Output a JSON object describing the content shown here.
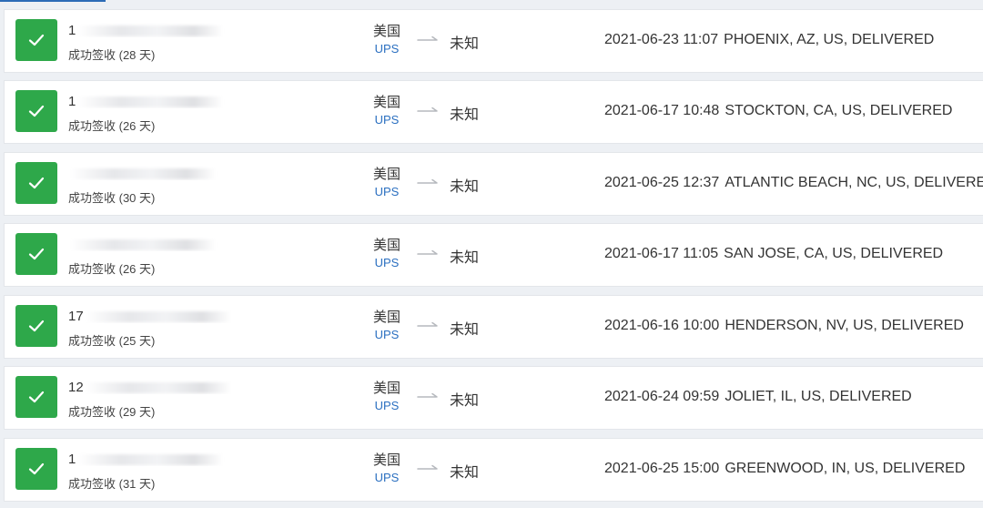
{
  "colors": {
    "success": "#2ea84a",
    "carrier_link": "#2a6fc0",
    "tab_accent": "#2c6bb6"
  },
  "icons": {
    "status": "check-icon",
    "route": "arrow-right-icon"
  },
  "shipments": [
    {
      "tracking_visible": "1",
      "tracking_tail": "",
      "status": "成功签收 (28 天)",
      "origin_country": "美国",
      "carrier": "UPS",
      "destination": "未知",
      "event_time": "2021-06-23 11:07",
      "event_text": "PHOENIX, AZ, US, DELIVERED"
    },
    {
      "tracking_visible": "1",
      "tracking_tail": "",
      "status": "成功签收 (26 天)",
      "origin_country": "美国",
      "carrier": "UPS",
      "destination": "未知",
      "event_time": "2021-06-17 10:48",
      "event_text": "STOCKTON, CA, US, DELIVERED"
    },
    {
      "tracking_visible": "",
      "tracking_tail": "",
      "status": "成功签收 (30 天)",
      "origin_country": "美国",
      "carrier": "UPS",
      "destination": "未知",
      "event_time": "2021-06-25 12:37",
      "event_text": "ATLANTIC BEACH, NC, US, DELIVERED"
    },
    {
      "tracking_visible": "",
      "tracking_tail": "",
      "status": "成功签收 (26 天)",
      "origin_country": "美国",
      "carrier": "UPS",
      "destination": "未知",
      "event_time": "2021-06-17 11:05",
      "event_text": "SAN JOSE, CA, US, DELIVERED"
    },
    {
      "tracking_visible": "17",
      "tracking_tail": "",
      "status": "成功签收 (25 天)",
      "origin_country": "美国",
      "carrier": "UPS",
      "destination": "未知",
      "event_time": "2021-06-16 10:00",
      "event_text": "HENDERSON, NV, US, DELIVERED"
    },
    {
      "tracking_visible": "12",
      "tracking_tail": "",
      "status": "成功签收 (29 天)",
      "origin_country": "美国",
      "carrier": "UPS",
      "destination": "未知",
      "event_time": "2021-06-24 09:59",
      "event_text": "JOLIET, IL, US, DELIVERED"
    },
    {
      "tracking_visible": "1",
      "tracking_tail": "",
      "status": "成功签收 (31 天)",
      "origin_country": "美国",
      "carrier": "UPS",
      "destination": "未知",
      "event_time": "2021-06-25 15:00",
      "event_text": "GREENWOOD, IN, US, DELIVERED"
    }
  ]
}
